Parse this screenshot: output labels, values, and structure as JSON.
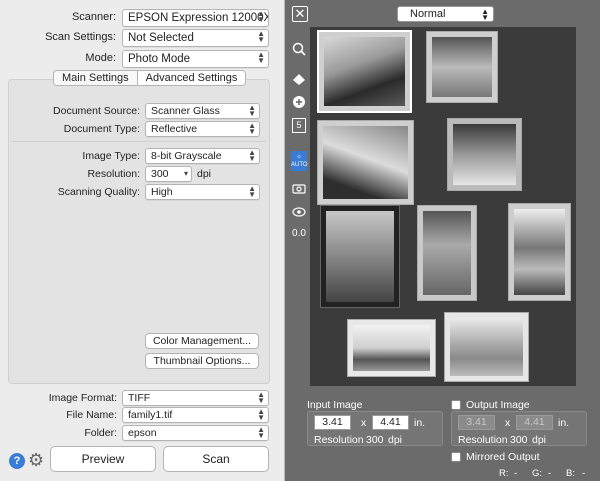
{
  "scanner": {
    "label": "Scanner:",
    "value": "EPSON Expression 12000X..."
  },
  "scan_settings": {
    "label": "Scan Settings:",
    "value": "Not Selected"
  },
  "mode": {
    "label": "Mode:",
    "value": "Photo Mode"
  },
  "tabs": [
    {
      "label": "Main Settings"
    },
    {
      "label": "Advanced Settings"
    }
  ],
  "document_source": {
    "label": "Document Source:",
    "value": "Scanner Glass"
  },
  "document_type": {
    "label": "Document Type:",
    "value": "Reflective"
  },
  "image_type": {
    "label": "Image Type:",
    "value": "8-bit Grayscale"
  },
  "resolution": {
    "label": "Resolution:",
    "value": "300",
    "unit": "dpi"
  },
  "scanning_quality": {
    "label": "Scanning Quality:",
    "value": "High"
  },
  "buttons": {
    "color_management": "Color Management...",
    "thumbnail_options": "Thumbnail Options...",
    "preview": "Preview",
    "scan": "Scan"
  },
  "image_format": {
    "label": "Image Format:",
    "value": "TIFF"
  },
  "file_name": {
    "label": "File Name:",
    "value": "family1.tif"
  },
  "folder": {
    "label": "Folder:",
    "value": "epson"
  },
  "help_label": "?",
  "preview_panel": {
    "view_mode": "Normal",
    "close_label": "✕",
    "count_badge": "5",
    "auto_label": "AUTO",
    "zero_value": "0.0",
    "input_image": {
      "title": "Input Image",
      "width": "3.41",
      "x_label": "x",
      "height": "4.41",
      "unit": "in.",
      "resolution_label": "Resolution",
      "resolution_value": "300",
      "resolution_unit": "dpi"
    },
    "output_image": {
      "title": "Output Image",
      "width": "3.41",
      "x_label": "x",
      "height": "4.41",
      "unit": "in.",
      "resolution_label": "Resolution",
      "resolution_value": "300",
      "resolution_unit": "dpi"
    },
    "mirrored_output": "Mirrored Output",
    "rgb_readout": {
      "r": "R:",
      "r_val": "-",
      "g": "G:",
      "g_val": "-",
      "b": "B:",
      "b_val": "-"
    }
  },
  "colors": {
    "panel_bg": "#ececec",
    "preview_bg": "#6b6b6b",
    "scan_bed": "#3b3b3b",
    "accent": "#3a7bd5"
  }
}
